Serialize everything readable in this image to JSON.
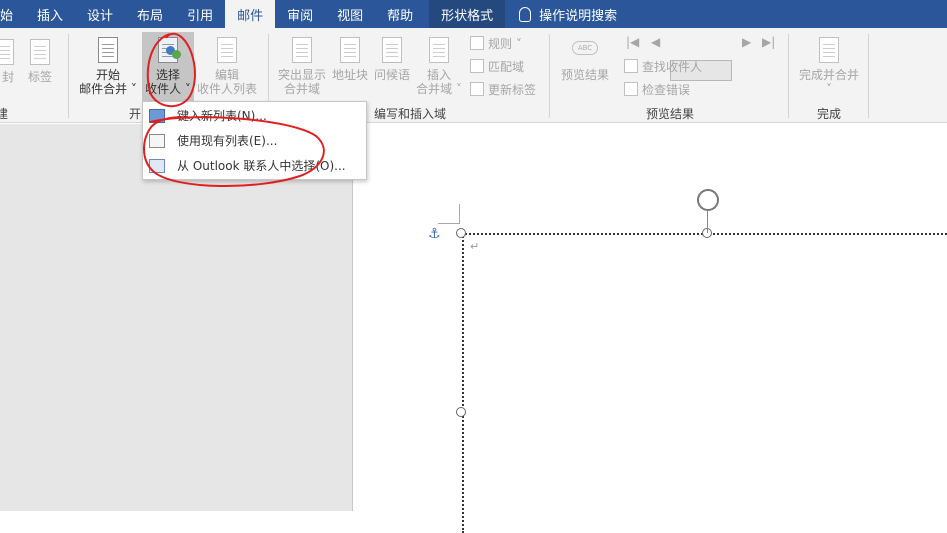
{
  "tabs": [
    {
      "label": "始",
      "active": false
    },
    {
      "label": "插入",
      "active": false
    },
    {
      "label": "设计",
      "active": false
    },
    {
      "label": "布局",
      "active": false
    },
    {
      "label": "引用",
      "active": false
    },
    {
      "label": "邮件",
      "active": true
    },
    {
      "label": "审阅",
      "active": false
    },
    {
      "label": "视图",
      "active": false
    },
    {
      "label": "帮助",
      "active": false
    }
  ],
  "shape_tab": "形状格式",
  "tell_me": "操作说明搜索",
  "ribbon": {
    "create_group": {
      "envelope_label": "封",
      "labels_label": "标签",
      "group_label": "建"
    },
    "start_group": {
      "start_line1": "开始",
      "start_line2": "邮件合并 ˅",
      "select_line1": "选择",
      "select_line2": "收件人 ˅",
      "edit_line1": "编辑",
      "edit_line2": "收件人列表",
      "group_label": "开"
    },
    "write_group": {
      "highlight_line1": "突出显示",
      "highlight_line2": "合并域",
      "address_label": "地址块",
      "greeting_label": "问候语",
      "insert_line1": "插入",
      "insert_line2": "合并域 ˅",
      "rules_label": "规则 ˅",
      "match_label": "匹配域",
      "update_label": "更新标签",
      "group_label": "编写和插入域"
    },
    "preview_group": {
      "preview_label": "预览结果",
      "find_label": "查找收件人",
      "check_label": "检查错误",
      "group_label": "预览结果"
    },
    "finish_group": {
      "finish_label": "完成并合并",
      "finish_arrow": "˅",
      "group_label": "完成"
    }
  },
  "dropdown": {
    "items": [
      {
        "label": "键入新列表(N)..."
      },
      {
        "label": "使用现有列表(E)..."
      },
      {
        "label": "从 Outlook 联系人中选择(O)..."
      }
    ]
  },
  "document": {
    "para_mark": "↵"
  },
  "colors": {
    "tab_bar": "#2b579a",
    "annotation": "#e02020"
  },
  "icons": {
    "rotate": "rotate-handle-icon",
    "anchor": "anchor-icon"
  }
}
